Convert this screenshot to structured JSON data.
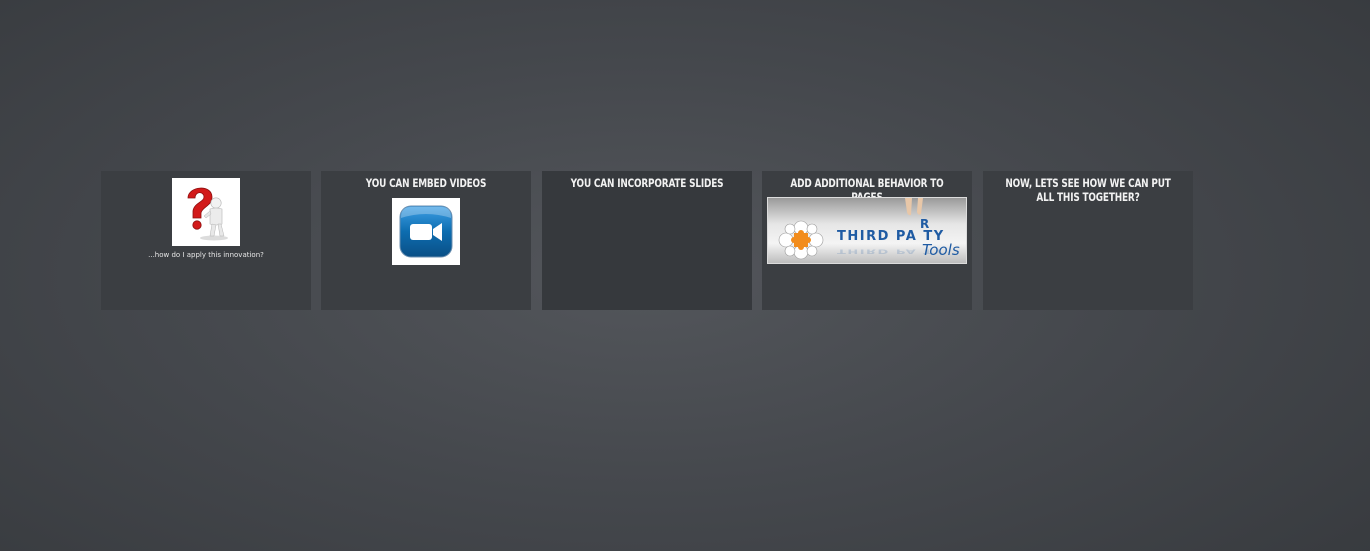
{
  "slides": [
    {
      "title": "",
      "caption": "...how do I apply this innovation?",
      "image_icon": "question-mark-figure-icon"
    },
    {
      "title": "YOU CAN EMBED VIDEOS",
      "image_icon": "video-camera-icon"
    },
    {
      "title": "YOU CAN INCORPORATE SLIDES"
    },
    {
      "title": "ADD ADDITIONAL BEHAVIOR TO PAGES",
      "image_icon": "third-party-tools-logo",
      "image_text_main": "THIRD PA TY",
      "image_text_r": "R",
      "image_text_tools": "Tools"
    },
    {
      "title": "NOW, LETS SEE HOW WE CAN PUT ALL THIS TOGETHER?"
    }
  ],
  "colors": {
    "tile_bg": "#3b3e42",
    "active_tile_bg": "#36393d",
    "title_text": "#f2f2f2",
    "question_red": "#d21a1a",
    "video_blue": "#0d6db0",
    "logo_blue": "#1f5ba3",
    "logo_orange": "#f28c1c"
  }
}
